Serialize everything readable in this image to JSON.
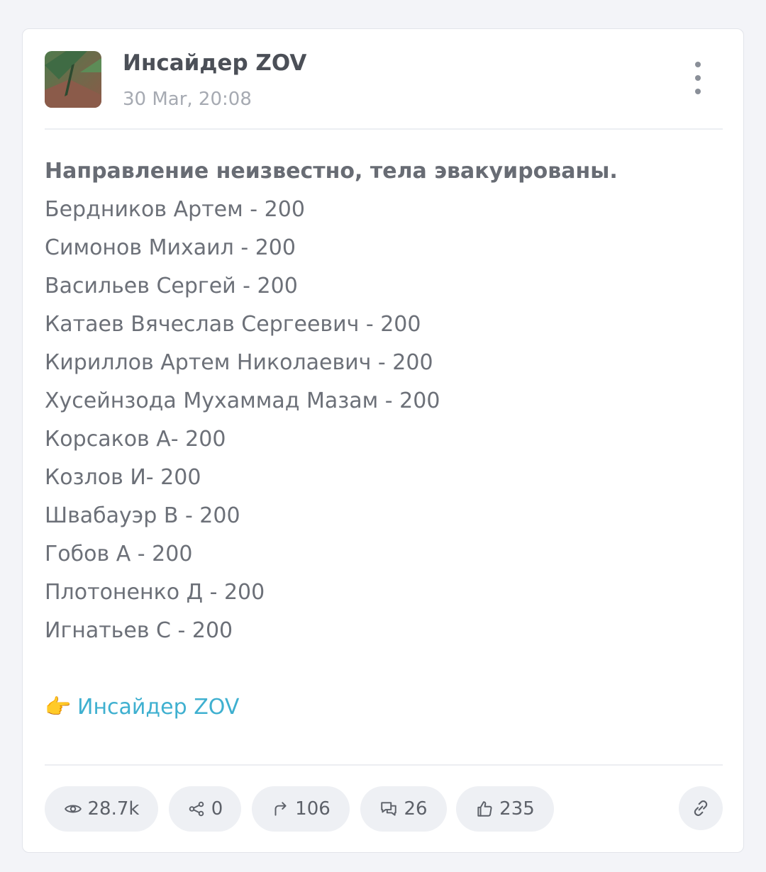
{
  "post": {
    "channel_name": "Инсайдер ZOV",
    "date": "30 Mar, 20:08",
    "avatar_icon": "channel-avatar-image",
    "menu_icon": "vertical-dots-icon",
    "headline": "Направление неизвестно, тела эвакуированы.",
    "lines": [
      "Бердников Артем - 200",
      "Симонов Михаил - 200",
      "Васильев Сергей - 200",
      "Катаев Вячеслав Сергеевич - 200",
      "Кириллов Артем Николаевич - 200",
      "Хусейнзода Мухаммад Мазам - 200",
      "Корсаков А- 200",
      "Козлов И- 200",
      "Швабауэр В - 200",
      "Гобов А - 200",
      "Плотоненко Д - 200",
      "Игнатьев С - 200"
    ],
    "link_emoji": "👉",
    "link_text": "Инсайдер ZOV"
  },
  "stats": {
    "views": "28.7k",
    "shares": "0",
    "forwards": "106",
    "comments": "26",
    "reactions": "235"
  },
  "colors": {
    "background": "#f3f4f8",
    "card": "#ffffff",
    "link": "#3fb0d0",
    "text": "#6c7078",
    "pill": "#eef0f4"
  }
}
